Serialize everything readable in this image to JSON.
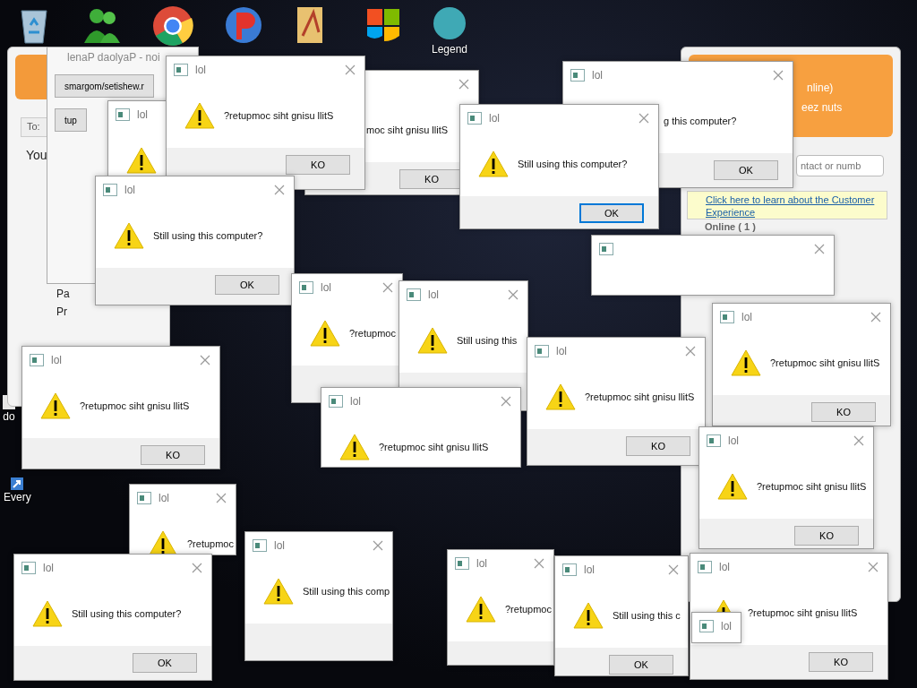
{
  "desktop_icons": [
    {
      "kind": "trash"
    },
    {
      "kind": "people"
    },
    {
      "kind": "browser"
    },
    {
      "kind": "app"
    },
    {
      "kind": "folder"
    },
    {
      "kind": "shield"
    },
    {
      "kind": "avatar",
      "label": "Legend"
    },
    {
      "kind": "doc",
      "label": "do"
    },
    {
      "kind": "link",
      "label": "Every"
    }
  ],
  "chat_window": {
    "to_label": "To:",
    "message": "You",
    "lines": [
      "Pa",
      "Pr"
    ]
  },
  "payload_window": {
    "title": "lenaP daolyaP - noi",
    "buttons": [
      "smargom/setishew.r",
      "tup"
    ]
  },
  "messenger_window": {
    "status": "nline)",
    "mood": "eez nuts",
    "search": {
      "placeholder": "ntact or numb"
    },
    "link": "Click here to learn about the Customer Experience",
    "group": "Online ( 1 )"
  },
  "dialogs": [
    {
      "title": "lol",
      "warning": true,
      "message": "?retupmoc siht gnisu llitS",
      "button": {
        "label": "KO",
        "focused": false
      }
    },
    {
      "message": "moc siht gnisu llitS",
      "button": {
        "label": "KO",
        "focused": false
      }
    },
    {
      "title": "lol",
      "message": "g this computer?",
      "button": {
        "label": "OK",
        "focused": false
      }
    },
    {
      "title": "lol",
      "warning": true
    },
    {
      "title": "lol",
      "warning": true,
      "message": "Still using this computer?",
      "button": {
        "label": "OK",
        "focused": true
      }
    },
    {
      "title": "lol",
      "warning": true,
      "message": "Still using this computer?",
      "button": {
        "label": "OK",
        "focused": false
      }
    },
    {
      "title": "lol",
      "warning": true,
      "message": "?retupmoc"
    },
    {
      "title": "lol",
      "warning": true,
      "message": "Still using this"
    },
    {
      "title": "lol",
      "warning": true,
      "message": "?retupmoc siht gnisu llitS",
      "button": {
        "label": "KO",
        "focused": false
      }
    },
    {
      "title": "lol",
      "warning": true,
      "message": "?retupmoc siht gnisu llitS",
      "button": {
        "label": "KO",
        "focused": false
      }
    },
    {
      "title": "lol",
      "warning": true,
      "message": "?retupmoc siht gnisu llitS"
    },
    {
      "title": "lol",
      "warning": true,
      "message": "?retupmoc siht gnisu llitS",
      "button": {
        "label": "KO",
        "focused": false
      }
    },
    {
      "title": "lol",
      "warning": true,
      "message": "?retupmoc siht gnisu llitS",
      "button": {
        "label": "KO",
        "focused": false
      }
    },
    {
      "title": "lol",
      "warning": true,
      "message": "?retupmoc"
    },
    {
      "title": "lol",
      "warning": true,
      "message": "Still using this comp"
    },
    {
      "title": "lol",
      "warning": true,
      "message": "Still using this computer?",
      "button": {
        "label": "OK",
        "focused": false
      }
    },
    {
      "title": "lol",
      "warning": true,
      "message": "?retupmoc"
    },
    {
      "title": "lol",
      "warning": true,
      "message": "Still using this c",
      "button": {
        "label": "OK",
        "focused": false
      }
    },
    {
      "title": "lol",
      "warning": true,
      "message": "?retupmoc siht gnisu llitS",
      "button": {
        "label": "KO",
        "focused": false
      }
    },
    {
      "title": "lol"
    }
  ]
}
